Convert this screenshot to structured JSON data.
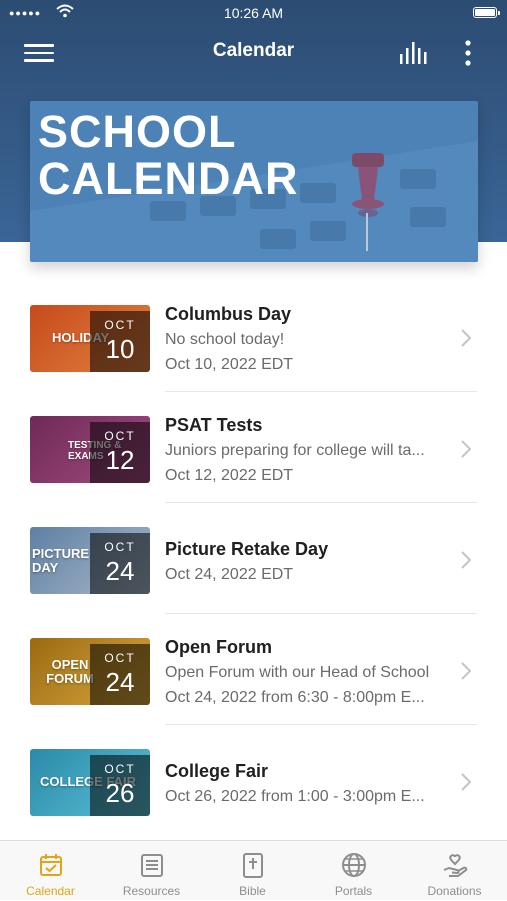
{
  "status_bar": {
    "time": "10:26 AM"
  },
  "nav": {
    "title": "Calendar"
  },
  "banner": {
    "line1": "SCHOOL",
    "line2": "CALENDAR"
  },
  "events": [
    {
      "title": "Columbus Day",
      "subtitle": "No school today!",
      "when": "Oct 10, 2022 EDT",
      "month": "OCT",
      "day": "10",
      "thumb_label": "HOLIDAY",
      "thumb_color": "#d3622a"
    },
    {
      "title": "PSAT Tests",
      "subtitle": "Juniors preparing for college will ta...",
      "when": "Oct 12, 2022 EDT",
      "month": "OCT",
      "day": "12",
      "thumb_label": "TESTING & EXAMS",
      "thumb_color": "#8a3d6e"
    },
    {
      "title": "Picture Retake Day",
      "subtitle": "",
      "when": "Oct 24, 2022 EDT",
      "month": "OCT",
      "day": "24",
      "thumb_label": "PICTURE DAY",
      "thumb_color": "#7a97b5"
    },
    {
      "title": "Open Forum",
      "subtitle": "Open Forum with our Head of School",
      "when": "Oct 24, 2022 from 6:30 - 8:00pm E...",
      "month": "OCT",
      "day": "24",
      "thumb_label": "OPEN FORUM",
      "thumb_color": "#c08a25"
    },
    {
      "title": "College Fair",
      "subtitle": "",
      "when": "Oct 26, 2022 from 1:00 - 3:00pm E...",
      "month": "OCT",
      "day": "26",
      "thumb_label": "COLLEGE FAIR",
      "thumb_color": "#3a9bb5"
    }
  ],
  "tabs": [
    {
      "label": "Calendar",
      "icon": "calendar-icon",
      "active": true
    },
    {
      "label": "Resources",
      "icon": "resources-icon",
      "active": false
    },
    {
      "label": "Bible",
      "icon": "bible-icon",
      "active": false
    },
    {
      "label": "Portals",
      "icon": "globe-icon",
      "active": false
    },
    {
      "label": "Donations",
      "icon": "donations-icon",
      "active": false
    }
  ],
  "colors": {
    "header": "#2c4c72",
    "accent": "#e0a617",
    "banner": "#4d82b7"
  }
}
